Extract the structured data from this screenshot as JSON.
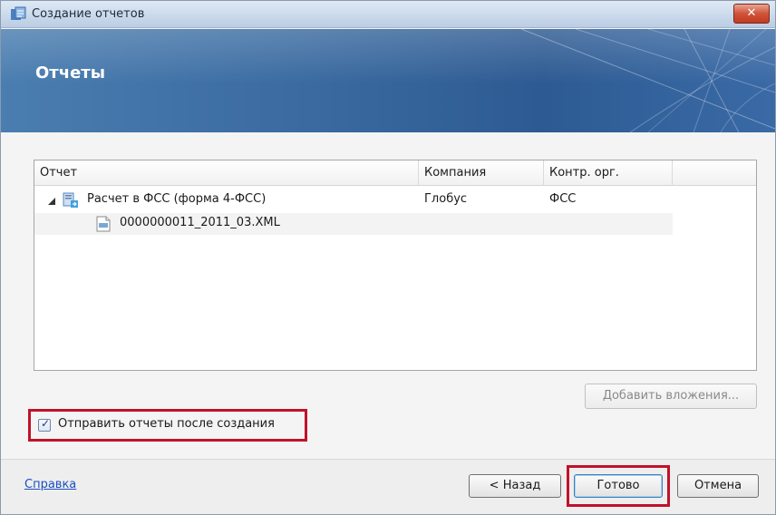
{
  "window": {
    "title": "Создание отчетов",
    "close_glyph": "✕"
  },
  "banner": {
    "title": "Отчеты"
  },
  "grid": {
    "columns": [
      "Отчет",
      "Компания",
      "Контр. орг."
    ],
    "rows": [
      {
        "label": "Расчет в ФСС (форма 4-ФСС)",
        "company": "Глобус",
        "control": "ФСС",
        "icon": "report-icon",
        "expanded": true
      },
      {
        "label": "0000000011_2011_03.XML",
        "icon": "xml-file-icon"
      }
    ]
  },
  "attach_button": {
    "label": "Добавить вложения..."
  },
  "send_checkbox": {
    "label": "Отправить отчеты после создания",
    "checked": true
  },
  "footer": {
    "help_link": "Справка",
    "back_label": "< Назад",
    "done_label": "Готово",
    "cancel_label": "Отмена"
  },
  "colors": {
    "highlight": "#c0122a",
    "banner": "#3a6aa0",
    "link": "#1a4fc0"
  }
}
